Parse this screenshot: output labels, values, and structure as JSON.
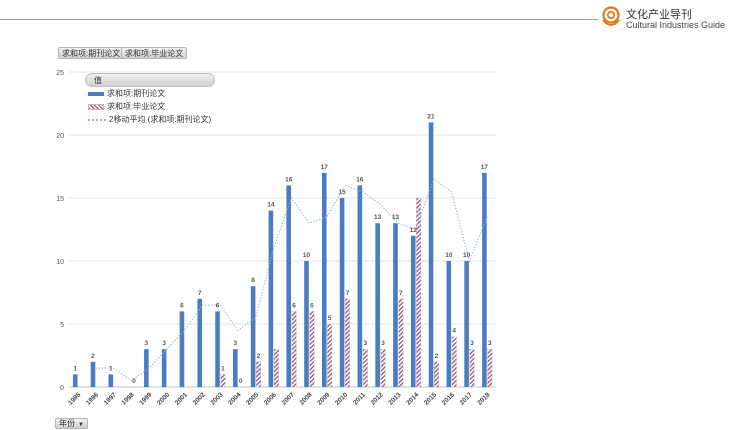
{
  "header": {
    "brand_cn": "文化产业导刊",
    "brand_en": "Cultural Industries Guide"
  },
  "buttons": {
    "field1": "求和项:期刊论文",
    "field2": "求和项:毕业论文",
    "year_filter": "年份"
  },
  "legend": {
    "title": "值",
    "items": [
      "求和项:期刊论文",
      "求和项:毕业论文",
      "2移动平均 (求和项:期刊论文)"
    ]
  },
  "colors": {
    "journal": "#4a7cc0",
    "thesis_stripe": "#9a5f85",
    "moving_avg": "#8fb4e3",
    "grid": "#dcdcdc"
  },
  "chart_data": {
    "type": "bar",
    "categories": [
      "1995",
      "1996",
      "1997",
      "1998",
      "1999",
      "2000",
      "2001",
      "2002",
      "2003",
      "2004",
      "2005",
      "2006",
      "2007",
      "2008",
      "2009",
      "2010",
      "2011",
      "2012",
      "2013",
      "2014",
      "2015",
      "2016",
      "2017",
      "2018"
    ],
    "series": [
      {
        "name": "求和项:期刊论文",
        "style": "solid",
        "values": [
          1,
          2,
          1,
          null,
          3,
          3,
          6,
          7,
          6,
          3,
          8,
          14,
          16,
          10,
          17,
          15,
          16,
          13,
          13,
          12,
          21,
          10,
          10,
          17
        ]
      },
      {
        "name": "求和项:毕业论文",
        "style": "hatched",
        "values": [
          null,
          null,
          null,
          0,
          null,
          null,
          null,
          null,
          1,
          0,
          2,
          3,
          6,
          6,
          5,
          7,
          3,
          3,
          7,
          15,
          2,
          4,
          3,
          3
        ]
      },
      {
        "name": "2移动平均 (求和项:期刊论文)",
        "style": "dotted-line",
        "values": [
          null,
          1.5,
          1.5,
          0.5,
          1.5,
          3,
          4.5,
          6.5,
          6.5,
          4.5,
          5.5,
          11,
          15,
          13,
          13.5,
          16,
          15.5,
          14.5,
          13,
          12.5,
          16.5,
          15.5,
          10,
          13.5
        ]
      }
    ],
    "data_labels": {
      "journal": [
        "1",
        "2",
        "1",
        "",
        "3",
        "3",
        "6",
        "7",
        "6",
        "3",
        "8",
        "14",
        "16",
        "10",
        "17",
        "15",
        "16",
        "13",
        "13",
        "12",
        "21",
        "10",
        "10",
        "17"
      ],
      "thesis": [
        "",
        "",
        "",
        "0",
        "",
        "",
        "",
        "",
        "1",
        "0",
        "2",
        "",
        "6",
        "6",
        "5",
        "7",
        "3",
        "3",
        "7",
        "",
        "2",
        "4",
        "3",
        "3"
      ]
    },
    "ylim": [
      0,
      25
    ],
    "yticks": [
      "0",
      "5",
      "10",
      "15",
      "20",
      "25"
    ],
    "grid": true,
    "legend_position": "top-left"
  }
}
